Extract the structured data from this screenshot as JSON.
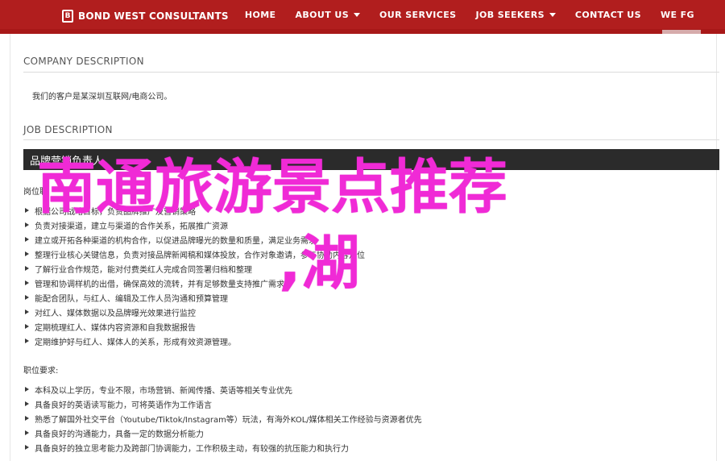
{
  "header": {
    "logo_text": "BOND WEST CONSULTANTS",
    "logo_mark": "B",
    "nav": [
      {
        "label": "HOME",
        "dropdown": false
      },
      {
        "label": "ABOUT US",
        "dropdown": true
      },
      {
        "label": "OUR SERVICES",
        "dropdown": false
      },
      {
        "label": "JOB SEEKERS",
        "dropdown": true
      },
      {
        "label": "CONTACT US",
        "dropdown": false
      },
      {
        "label": "WE FG",
        "dropdown": false
      }
    ],
    "brand_color": "#b11e1e"
  },
  "company": {
    "title": "COMPANY DESCRIPTION",
    "text": "我们的客户是某深圳互联网/电商公司。"
  },
  "job": {
    "title": "JOB DESCRIPTION",
    "position_name": "品牌营销负责人",
    "duties_label": "岗位职",
    "duties": [
      "根据公司战略目标，负责品牌推广及营销策略",
      "负责对接渠道，建立与渠道的合作关系，拓展推广资源",
      "建立或开拓各种渠道的机构合作，以促进品牌曝光的数量和质量，满足业务需求",
      "整理行业核心关键信息，负责对接品牌新闻稿和媒体投放，合作对象邀请，参与协助内容定位",
      "了解行业合作规范，能对付费类红人完成合同签署归档和整理",
      "管理和协调样机的出借，确保高效的流转，并有足够数量支持推广需求",
      "能配合团队，与红人、编辑及工作人员沟通和预算管理",
      "对红人、媒体数据以及品牌曝光效果进行监控",
      "定期梳理红人、媒体内容资源和自我数据报告",
      "定期维护好与红人、媒体人的关系，形成有效资源管理。"
    ],
    "requirements_label": "职位要求:",
    "requirements": [
      "本科及以上学历，专业不限，市场营销、新闻传播、英语等相关专业优先",
      "具备良好的英语读写能力，可将英语作为工作语言",
      "熟悉了解国外社交平台（Youtube/Tiktok/Instagram等）玩法，有海外KOL/媒体相关工作经验与资源者优先",
      "具备良好的沟通能力，具备一定的数据分析能力",
      "具备良好的独立思考能力及跨部门协调能力，工作积极主动，有较强的抗压能力和执行力"
    ]
  },
  "overlay": {
    "line1": "南通旅游景点推荐",
    "line2": ",湖",
    "color": "#f02ad6"
  }
}
